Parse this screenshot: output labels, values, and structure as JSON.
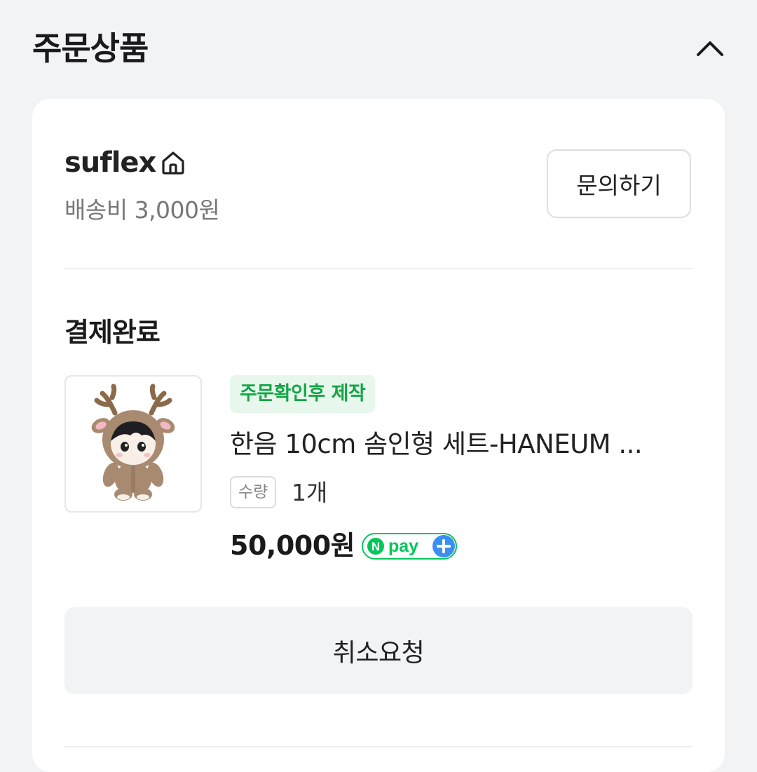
{
  "section": {
    "title": "주문상품",
    "collapse_icon": "chevron-up-icon"
  },
  "seller": {
    "name": "suflex",
    "home_icon": "home-icon",
    "shipping_fee": "배송비 3,000원",
    "inquiry_label": "문의하기"
  },
  "order": {
    "status": "결제완료",
    "badge": "주문확인후 제작",
    "product_name": "한음 10cm 솜인형 세트-HANEUM ...",
    "qty_label": "수량",
    "qty_value": "1개",
    "price": "50,000원",
    "payment_badge": "npay+",
    "cancel_label": "취소요청"
  },
  "colors": {
    "page_bg": "#f2f3f5",
    "card_bg": "#ffffff",
    "badge_bg": "#e7f7ec",
    "badge_text": "#14a546",
    "npay_green": "#03c75a",
    "npay_blue": "#3b8ff3"
  }
}
